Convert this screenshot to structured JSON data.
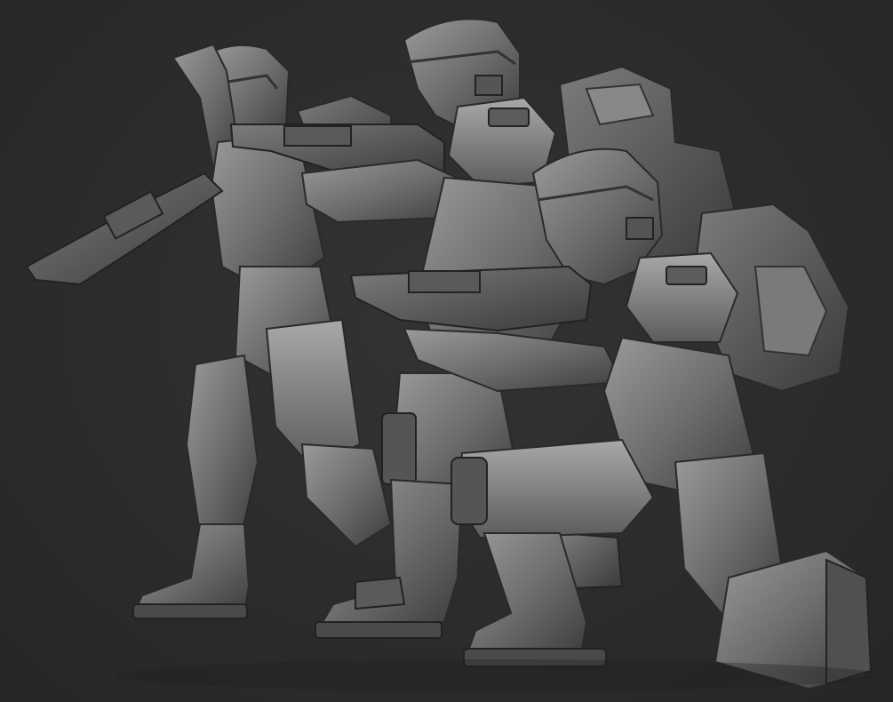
{
  "scene": {
    "subject": "clone-trooper-squad-sculpt-render",
    "background_color": "#2b2b2b",
    "clay_base_color": "#6e6e6e",
    "clay_light_color": "#9a9a9a",
    "clay_shadow_color": "#3c3c3c",
    "figure_count": 3
  }
}
